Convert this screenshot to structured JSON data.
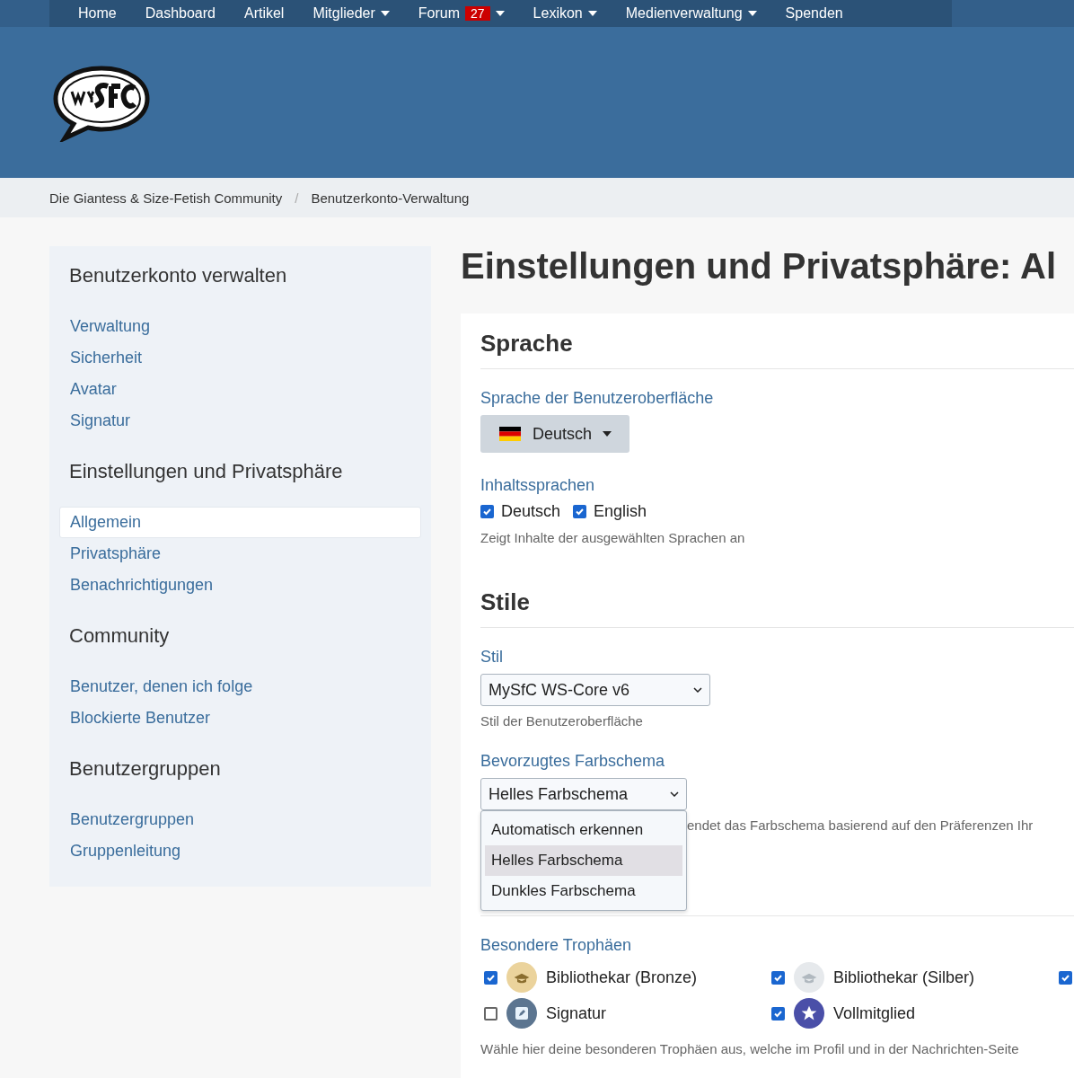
{
  "nav": [
    {
      "label": "Home",
      "caret": false
    },
    {
      "label": "Dashboard",
      "caret": false
    },
    {
      "label": "Artikel",
      "caret": false
    },
    {
      "label": "Mitglieder",
      "caret": true
    },
    {
      "label": "Forum",
      "badge": "27",
      "caret": true
    },
    {
      "label": "Lexikon",
      "caret": true
    },
    {
      "label": "Medienverwaltung",
      "caret": true
    },
    {
      "label": "Spenden",
      "caret": false
    }
  ],
  "breadcrumb_separator": "/",
  "breadcrumbs": [
    "Die Giantess & Size-Fetish Community",
    "Benutzerkonto-Verwaltung"
  ],
  "sidebar": [
    {
      "title": "Benutzerkonto verwalten",
      "items": [
        {
          "label": "Verwaltung",
          "selected": false
        },
        {
          "label": "Sicherheit",
          "selected": false
        },
        {
          "label": "Avatar",
          "selected": false
        },
        {
          "label": "Signatur",
          "selected": false
        }
      ]
    },
    {
      "title": "Einstellungen und Privatsphäre",
      "items": [
        {
          "label": "Allgemein",
          "selected": true
        },
        {
          "label": "Privatsphäre",
          "selected": false
        },
        {
          "label": "Benachrichtigungen",
          "selected": false
        }
      ]
    },
    {
      "title": "Community",
      "items": [
        {
          "label": "Benutzer, denen ich folge",
          "selected": false
        },
        {
          "label": "Blockierte Benutzer",
          "selected": false
        }
      ]
    },
    {
      "title": "Benutzergruppen",
      "items": [
        {
          "label": "Benutzergruppen",
          "selected": false
        },
        {
          "label": "Gruppenleitung",
          "selected": false
        }
      ]
    }
  ],
  "page_title": "Einstellungen und Privatsphäre: Al",
  "language": {
    "heading": "Sprache",
    "ui_label": "Sprache der Benutzeroberfläche",
    "ui_value": "Deutsch",
    "content_label": "Inhaltssprachen",
    "content_languages": [
      {
        "label": "Deutsch",
        "checked": true
      },
      {
        "label": "English",
        "checked": true
      }
    ],
    "content_hint": "Zeigt Inhalte der ausgewählten Sprachen an"
  },
  "styles": {
    "heading": "Stile",
    "style_label": "Stil",
    "style_value": "MySfC WS-Core v6",
    "style_hint": "Stil der Benutzeroberfläche",
    "scheme_label": "Bevorzugtes Farbschema",
    "scheme_value": "Helles Farbschema",
    "scheme_hint": "endet das Farbschema basierend auf den Präferenzen Ihr",
    "scheme_expanded": true,
    "scheme_options": [
      {
        "label": "Automatisch erkennen",
        "selected": false
      },
      {
        "label": "Helles Farbschema",
        "selected": true
      },
      {
        "label": "Dunkles Farbschema",
        "selected": false
      }
    ]
  },
  "trophies": {
    "label": "Besondere Trophäen",
    "items": [
      {
        "kind": "bronze",
        "label": "Bibliothekar (Bronze)",
        "checked": true
      },
      {
        "kind": "silver",
        "label": "Bibliothekar (Silber)",
        "checked": true
      },
      {
        "kind": "hidden",
        "checked": true
      },
      {
        "kind": "signature",
        "label": "Signatur",
        "checked": false
      },
      {
        "kind": "star",
        "label": "Vollmitglied",
        "checked": true
      }
    ],
    "hint": "Wähle hier deine besonderen Trophäen aus, welche im Profil und in der Nachrichten-Seite"
  }
}
